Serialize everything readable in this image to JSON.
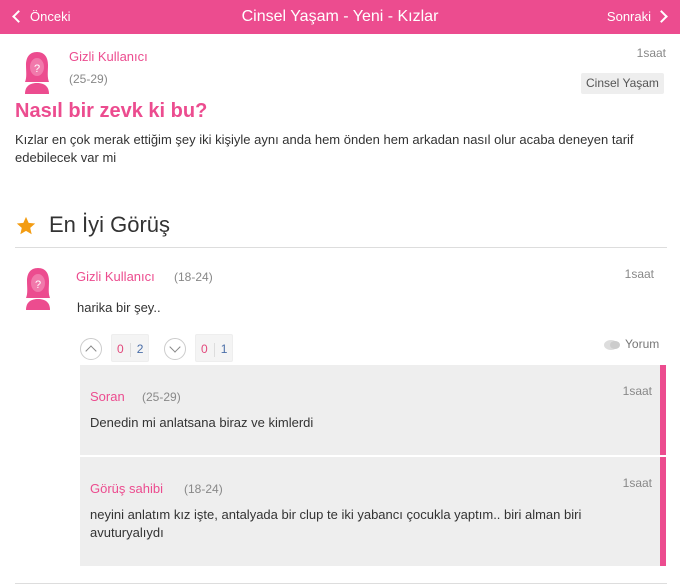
{
  "nav": {
    "prev_label": "Önceki",
    "title": "Cinsel Yaşam - Yeni - Kızlar",
    "next_label": "Sonraki"
  },
  "question": {
    "author": "Gizli Kullanıcı",
    "age": "(25-29)",
    "time": "1saat",
    "category": "Cinsel Yaşam",
    "title": "Nasıl bir zevk ki bu?",
    "body": "Kızlar en çok merak ettiğim şey iki kişiyle aynı anda hem önden hem arkadan nasıl olur acaba deneyen tarif edebilecek var mi"
  },
  "best_answer": {
    "section_label": "En İyi Görüş",
    "author": "Gizli Kullanıcı",
    "age": "(18-24)",
    "time": "1saat",
    "text": "harika bir şey..",
    "upvote": {
      "neg": "0",
      "pos": "2"
    },
    "downvote": {
      "neg": "0",
      "pos": "1"
    },
    "comment_label": "Yorum"
  },
  "replies": [
    {
      "author": "Soran",
      "age": "(25-29)",
      "time": "1saat",
      "text": "Denedin mi anlatsana biraz ve kimlerdi"
    },
    {
      "author": "Görüş sahibi",
      "age": "(18-24)",
      "time": "1saat",
      "text": "neyini anlatım kız işte, antalyada bir clup te iki yabancı çocukla yaptım.. biri alman biri avuturyalıydı"
    }
  ],
  "colors": {
    "accent": "#ec4c8f",
    "star": "#f39c12"
  },
  "icons": {
    "star": "star-icon",
    "avatar": "female-avatar-icon",
    "comment": "comment-bubble-icon"
  }
}
